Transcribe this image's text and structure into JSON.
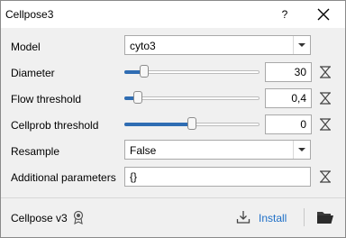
{
  "window": {
    "title": "Cellpose3",
    "help_label": "?"
  },
  "form": {
    "model": {
      "label": "Model",
      "value": "cyto3"
    },
    "diameter": {
      "label": "Diameter",
      "value": "30",
      "slider_fraction": 0.12
    },
    "flow_threshold": {
      "label": "Flow threshold",
      "value": "0,4",
      "slider_fraction": 0.07
    },
    "cellprob_threshold": {
      "label": "Cellprob threshold",
      "value": "0",
      "slider_fraction": 0.5
    },
    "resample": {
      "label": "Resample",
      "value": "False"
    },
    "additional_parameters": {
      "label": "Additional parameters",
      "value": "{}"
    }
  },
  "footer": {
    "plugin_name": "Cellpose v3",
    "install_label": "Install"
  },
  "icons": {
    "close": "close-icon",
    "dropdown": "chevron-down-icon",
    "reset": "reset-icon",
    "badge": "award-badge-icon",
    "install": "download-icon",
    "folder": "folder-open-icon"
  },
  "colors": {
    "accent": "#2f6db3",
    "link": "#1e6fc7"
  }
}
